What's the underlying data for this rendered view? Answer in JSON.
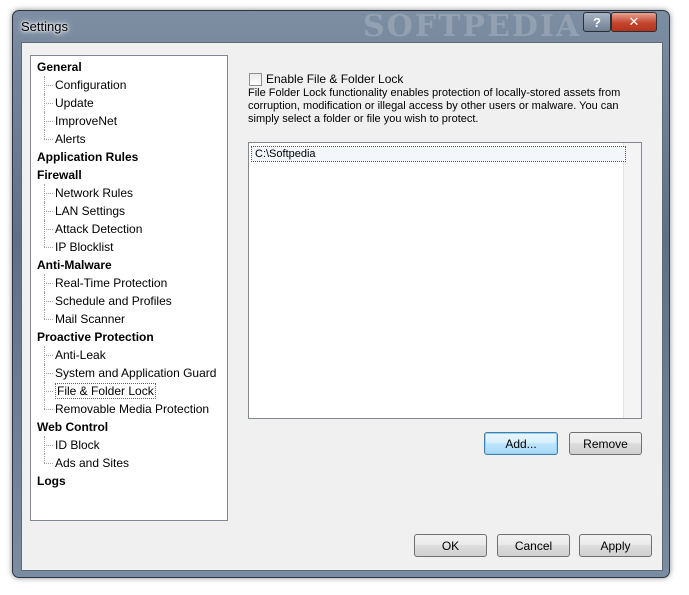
{
  "window": {
    "title": "Settings",
    "watermark": "SOFTPEDIA",
    "help_label": "?",
    "close_label": "✕"
  },
  "tree": [
    {
      "label": "General",
      "type": "cat"
    },
    {
      "label": "Configuration",
      "type": "child"
    },
    {
      "label": "Update",
      "type": "child"
    },
    {
      "label": "ImproveNet",
      "type": "child"
    },
    {
      "label": "Alerts",
      "type": "child"
    },
    {
      "label": "Application Rules",
      "type": "cat"
    },
    {
      "label": "Firewall",
      "type": "cat"
    },
    {
      "label": "Network Rules",
      "type": "child"
    },
    {
      "label": "LAN Settings",
      "type": "child"
    },
    {
      "label": "Attack Detection",
      "type": "child"
    },
    {
      "label": "IP Blocklist",
      "type": "child"
    },
    {
      "label": "Anti-Malware",
      "type": "cat"
    },
    {
      "label": "Real-Time Protection",
      "type": "child"
    },
    {
      "label": "Schedule and Profiles",
      "type": "child"
    },
    {
      "label": "Mail Scanner",
      "type": "child"
    },
    {
      "label": "Proactive Protection",
      "type": "cat"
    },
    {
      "label": "Anti-Leak",
      "type": "child"
    },
    {
      "label": "System and Application Guard",
      "type": "child"
    },
    {
      "label": "File & Folder Lock",
      "type": "child",
      "selected": true
    },
    {
      "label": "Removable Media Protection",
      "type": "child"
    },
    {
      "label": "Web Control",
      "type": "cat"
    },
    {
      "label": "ID Block",
      "type": "child"
    },
    {
      "label": "Ads and Sites",
      "type": "child"
    },
    {
      "label": "Logs",
      "type": "cat"
    }
  ],
  "panel": {
    "enable_label": "Enable File & Folder Lock",
    "enable_checked": false,
    "description": "File  Folder Lock functionality enables protection of locally-stored assets from corruption, modification or illegal access by other users or malware. You can simply select a folder or file you wish to protect.",
    "items": [
      "C:\\Softpedia"
    ],
    "add_label": "Add...",
    "remove_label": "Remove"
  },
  "footer": {
    "ok_label": "OK",
    "cancel_label": "Cancel",
    "apply_label": "Apply"
  }
}
